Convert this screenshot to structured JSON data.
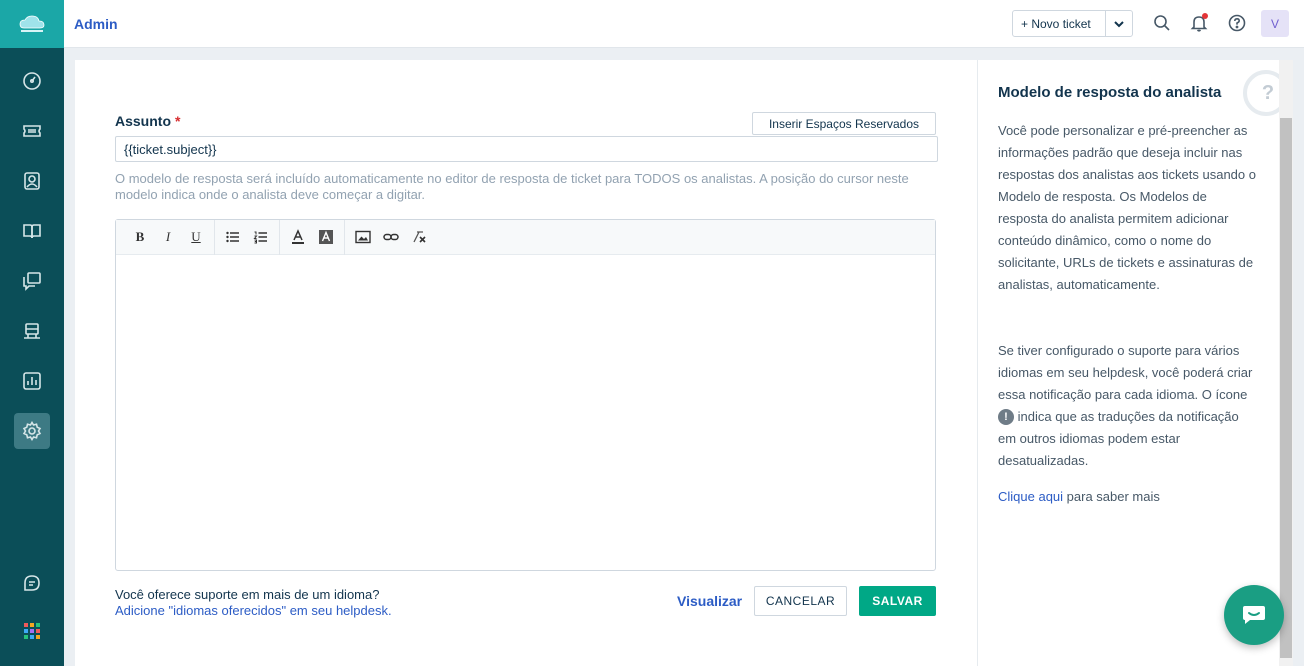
{
  "app": {
    "logo_icon": "cloud-logo-icon",
    "accent": "#2c5cc5",
    "sidebar_bg": "#0b4e58"
  },
  "sidebar": {
    "items": [
      {
        "icon": "dashboard-icon"
      },
      {
        "icon": "tickets-icon"
      },
      {
        "icon": "contacts-icon"
      },
      {
        "icon": "solutions-icon"
      },
      {
        "icon": "forums-icon"
      },
      {
        "icon": "groups-icon"
      },
      {
        "icon": "reports-icon"
      },
      {
        "icon": "admin-gear-icon",
        "active": true
      }
    ],
    "bottom": [
      {
        "icon": "chat-icon"
      },
      {
        "icon": "apps-grid-icon"
      }
    ]
  },
  "topbar": {
    "title": "Admin",
    "new_ticket_label": "+ Novo ticket",
    "avatar_initial": "V"
  },
  "form": {
    "subject_label": "Assunto",
    "required_mark": "*",
    "insert_placeholder_label": "Inserir Espaços Reservados",
    "subject_value": "{{ticket.subject}}",
    "help_text": "O modelo de resposta será incluído automaticamente no editor de resposta de ticket para TODOS os analistas. A posição do cursor neste modelo indica onde o analista deve começar a digitar.",
    "toolbar": {
      "bold": "B",
      "italic": "I",
      "underline": "U"
    },
    "language_question": "Você oferece suporte em mais de um idioma?",
    "language_link": "Adicione \"idiomas oferecidos\" em seu helpdesk.",
    "preview_label": "Visualizar",
    "cancel_label": "CANCELAR",
    "save_label": "SALVAR"
  },
  "info": {
    "title": "Modelo de resposta do analista",
    "p1": "Você pode personalizar e pré-preencher as informações padrão que deseja incluir nas respostas dos analistas aos tickets usando o Modelo de resposta. Os Modelos de resposta do analista permitem adicionar conteúdo dinâmico, como o nome do solicitante, URLs de tickets e assinaturas de analistas, automaticamente.",
    "p2_before": "Se tiver configurado o suporte para vários idiomas em seu helpdesk, você poderá criar essa notificação para cada idioma. O ícone",
    "p2_warn": "!",
    "p2_after": "indica que as traduções da notificação em outros idiomas podem estar desatualizadas.",
    "link_label": "Clique aqui",
    "link_after": "para saber mais",
    "help_glyph": "?"
  }
}
